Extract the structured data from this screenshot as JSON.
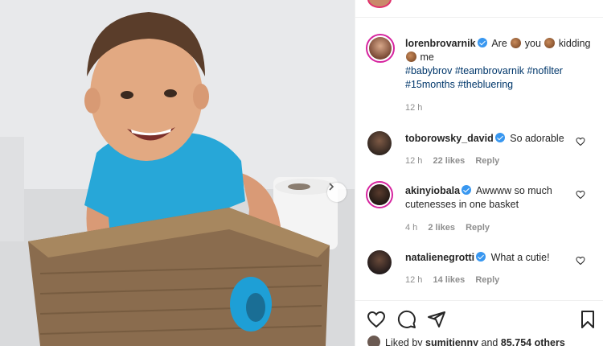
{
  "post": {
    "author": "lorenbrovarnik",
    "caption_segments": [
      "Are",
      "you",
      "kidding",
      "me"
    ],
    "hashtags_line1": "#babybrov #teambrovarnik #nofilter",
    "hashtags_line2": "#15months #thebluering",
    "time": "12 h"
  },
  "comments": [
    {
      "user": "toborowsky_david",
      "text": "So adorable",
      "time": "12 h",
      "likes": "22 likes",
      "reply": "Reply"
    },
    {
      "user": "akinyiobala",
      "text": "Awwww so much cutenesses in one basket",
      "time": "4 h",
      "likes": "2 likes",
      "reply": "Reply"
    },
    {
      "user": "natalienegrotti",
      "text": "What a cutie!",
      "time": "12 h",
      "likes": "14 likes",
      "reply": "Reply"
    }
  ],
  "likes_bar": {
    "prefix": "Liked by",
    "user": "sumitjenny",
    "and": "and",
    "others": "85,754 others"
  },
  "icons": [
    "next-arrow-icon",
    "verified-badge-icon",
    "heart-icon",
    "comment-icon",
    "share-icon",
    "bookmark-icon"
  ],
  "colors": {
    "link": "#00376b",
    "verified": "#3897f0",
    "muted": "#8e8e8e",
    "story_ring": "#d6249f"
  }
}
